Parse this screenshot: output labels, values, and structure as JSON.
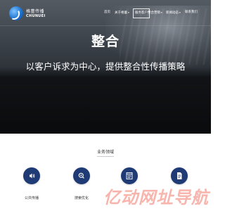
{
  "brand": {
    "name_cn": "格蕾传播",
    "name_en": "CHUNUEI"
  },
  "nav": {
    "items": [
      {
        "label": "首页",
        "has_dropdown": false,
        "boxed": false
      },
      {
        "label": "关于格蕾",
        "has_dropdown": true,
        "boxed": false
      },
      {
        "label": "服务客户",
        "has_dropdown": false,
        "boxed": true
      },
      {
        "label": "整合营销",
        "has_dropdown": true,
        "boxed": false
      },
      {
        "label": "新闻动态",
        "has_dropdown": true,
        "boxed": false
      },
      {
        "label": "联系我们",
        "has_dropdown": false,
        "boxed": false
      }
    ],
    "dropdown_glyph": "▾"
  },
  "hero": {
    "title": "整合",
    "subtitle": "以客户诉求为中心，提供整合性传播策略"
  },
  "business": {
    "title": "业务领域",
    "services": [
      {
        "label": "公共传播",
        "icon": "speaker-icon"
      },
      {
        "label": "搜索优化",
        "icon": "magnifier-icon"
      },
      {
        "label": "",
        "icon": "browser-window-icon"
      },
      {
        "label": "",
        "icon": "document-icon"
      }
    ]
  },
  "watermark": {
    "text": "亿动网址导航"
  },
  "colors": {
    "accent": "#1f3b75",
    "hero_dark": "#0a0b0d",
    "watermark": "#f07869"
  }
}
